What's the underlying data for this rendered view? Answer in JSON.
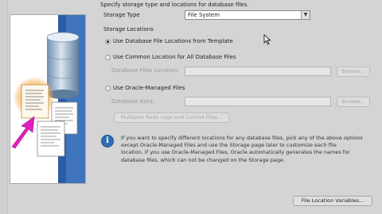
{
  "header": {
    "description": "Specify storage type and locations for database files."
  },
  "storage_type": {
    "label": "Storage Type",
    "selected": "File System",
    "arrow": "▼"
  },
  "storage_locations": {
    "label": "Storage Locations",
    "options": [
      {
        "label": "Use Database File Locations from Template",
        "checked": true
      },
      {
        "label": "Use Common Location for All Database Files",
        "checked": false
      },
      {
        "label": "Use Oracle-Managed Files",
        "checked": false
      }
    ],
    "database_files_location_label": "Database Files Location:",
    "database_area_label": "Database Area:",
    "browse_label": "Browse...",
    "multiplex_label": "Multiplex Redo Logs and Control Files..."
  },
  "info": {
    "icon": "info-icon",
    "lines": [
      "If you want to specify different locations for any database files, pick any of the above options",
      "except Oracle-Managed Files and use the Storage page later to customize each file",
      "location. If you use Oracle-Managed Files, Oracle automatically generates the names for",
      "database files, which can not be changed on the Storage page."
    ]
  },
  "footer": {
    "file_location_variables_label": "File Location Variables..."
  },
  "colors": {
    "background": "#d4d4d4",
    "info_blue": "#2d6fb3",
    "arrow_magenta": "#e020c0"
  }
}
